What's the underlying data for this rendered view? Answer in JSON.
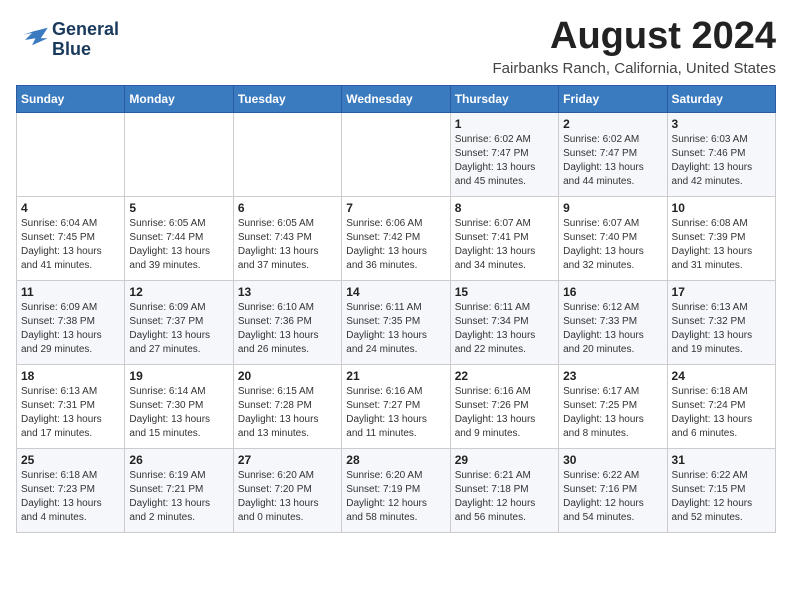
{
  "header": {
    "logo_line1": "General",
    "logo_line2": "Blue",
    "month_year": "August 2024",
    "location": "Fairbanks Ranch, California, United States"
  },
  "weekdays": [
    "Sunday",
    "Monday",
    "Tuesday",
    "Wednesday",
    "Thursday",
    "Friday",
    "Saturday"
  ],
  "weeks": [
    [
      {
        "day": "",
        "info": ""
      },
      {
        "day": "",
        "info": ""
      },
      {
        "day": "",
        "info": ""
      },
      {
        "day": "",
        "info": ""
      },
      {
        "day": "1",
        "info": "Sunrise: 6:02 AM\nSunset: 7:47 PM\nDaylight: 13 hours\nand 45 minutes."
      },
      {
        "day": "2",
        "info": "Sunrise: 6:02 AM\nSunset: 7:47 PM\nDaylight: 13 hours\nand 44 minutes."
      },
      {
        "day": "3",
        "info": "Sunrise: 6:03 AM\nSunset: 7:46 PM\nDaylight: 13 hours\nand 42 minutes."
      }
    ],
    [
      {
        "day": "4",
        "info": "Sunrise: 6:04 AM\nSunset: 7:45 PM\nDaylight: 13 hours\nand 41 minutes."
      },
      {
        "day": "5",
        "info": "Sunrise: 6:05 AM\nSunset: 7:44 PM\nDaylight: 13 hours\nand 39 minutes."
      },
      {
        "day": "6",
        "info": "Sunrise: 6:05 AM\nSunset: 7:43 PM\nDaylight: 13 hours\nand 37 minutes."
      },
      {
        "day": "7",
        "info": "Sunrise: 6:06 AM\nSunset: 7:42 PM\nDaylight: 13 hours\nand 36 minutes."
      },
      {
        "day": "8",
        "info": "Sunrise: 6:07 AM\nSunset: 7:41 PM\nDaylight: 13 hours\nand 34 minutes."
      },
      {
        "day": "9",
        "info": "Sunrise: 6:07 AM\nSunset: 7:40 PM\nDaylight: 13 hours\nand 32 minutes."
      },
      {
        "day": "10",
        "info": "Sunrise: 6:08 AM\nSunset: 7:39 PM\nDaylight: 13 hours\nand 31 minutes."
      }
    ],
    [
      {
        "day": "11",
        "info": "Sunrise: 6:09 AM\nSunset: 7:38 PM\nDaylight: 13 hours\nand 29 minutes."
      },
      {
        "day": "12",
        "info": "Sunrise: 6:09 AM\nSunset: 7:37 PM\nDaylight: 13 hours\nand 27 minutes."
      },
      {
        "day": "13",
        "info": "Sunrise: 6:10 AM\nSunset: 7:36 PM\nDaylight: 13 hours\nand 26 minutes."
      },
      {
        "day": "14",
        "info": "Sunrise: 6:11 AM\nSunset: 7:35 PM\nDaylight: 13 hours\nand 24 minutes."
      },
      {
        "day": "15",
        "info": "Sunrise: 6:11 AM\nSunset: 7:34 PM\nDaylight: 13 hours\nand 22 minutes."
      },
      {
        "day": "16",
        "info": "Sunrise: 6:12 AM\nSunset: 7:33 PM\nDaylight: 13 hours\nand 20 minutes."
      },
      {
        "day": "17",
        "info": "Sunrise: 6:13 AM\nSunset: 7:32 PM\nDaylight: 13 hours\nand 19 minutes."
      }
    ],
    [
      {
        "day": "18",
        "info": "Sunrise: 6:13 AM\nSunset: 7:31 PM\nDaylight: 13 hours\nand 17 minutes."
      },
      {
        "day": "19",
        "info": "Sunrise: 6:14 AM\nSunset: 7:30 PM\nDaylight: 13 hours\nand 15 minutes."
      },
      {
        "day": "20",
        "info": "Sunrise: 6:15 AM\nSunset: 7:28 PM\nDaylight: 13 hours\nand 13 minutes."
      },
      {
        "day": "21",
        "info": "Sunrise: 6:16 AM\nSunset: 7:27 PM\nDaylight: 13 hours\nand 11 minutes."
      },
      {
        "day": "22",
        "info": "Sunrise: 6:16 AM\nSunset: 7:26 PM\nDaylight: 13 hours\nand 9 minutes."
      },
      {
        "day": "23",
        "info": "Sunrise: 6:17 AM\nSunset: 7:25 PM\nDaylight: 13 hours\nand 8 minutes."
      },
      {
        "day": "24",
        "info": "Sunrise: 6:18 AM\nSunset: 7:24 PM\nDaylight: 13 hours\nand 6 minutes."
      }
    ],
    [
      {
        "day": "25",
        "info": "Sunrise: 6:18 AM\nSunset: 7:23 PM\nDaylight: 13 hours\nand 4 minutes."
      },
      {
        "day": "26",
        "info": "Sunrise: 6:19 AM\nSunset: 7:21 PM\nDaylight: 13 hours\nand 2 minutes."
      },
      {
        "day": "27",
        "info": "Sunrise: 6:20 AM\nSunset: 7:20 PM\nDaylight: 13 hours\nand 0 minutes."
      },
      {
        "day": "28",
        "info": "Sunrise: 6:20 AM\nSunset: 7:19 PM\nDaylight: 12 hours\nand 58 minutes."
      },
      {
        "day": "29",
        "info": "Sunrise: 6:21 AM\nSunset: 7:18 PM\nDaylight: 12 hours\nand 56 minutes."
      },
      {
        "day": "30",
        "info": "Sunrise: 6:22 AM\nSunset: 7:16 PM\nDaylight: 12 hours\nand 54 minutes."
      },
      {
        "day": "31",
        "info": "Sunrise: 6:22 AM\nSunset: 7:15 PM\nDaylight: 12 hours\nand 52 minutes."
      }
    ]
  ]
}
